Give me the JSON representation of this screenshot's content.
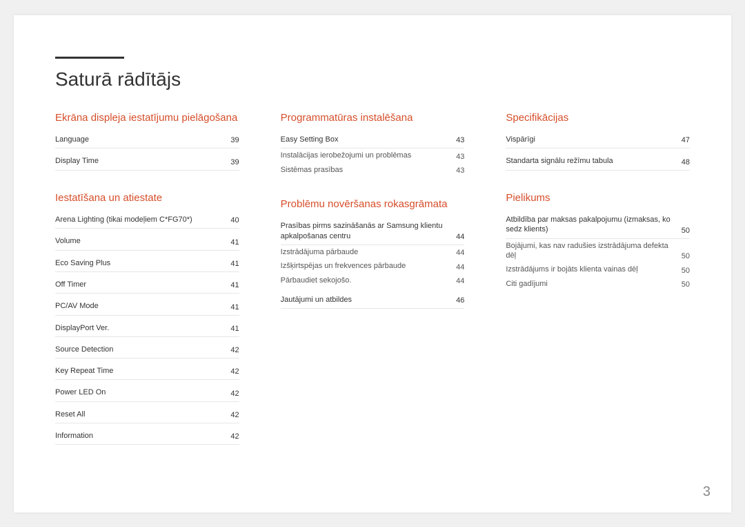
{
  "title": "Saturā rādītājs",
  "page_number": "3",
  "columns": [
    {
      "sections": [
        {
          "title": "Ekrāna displeja iestatījumu pielāgošana",
          "entries": [
            {
              "label": "Language",
              "page": "39",
              "sub": false
            },
            {
              "label": "Display Time",
              "page": "39",
              "sub": false
            }
          ]
        },
        {
          "title": "Iestatīšana un atiestate",
          "entries": [
            {
              "label": "Arena Lighting (tikai modeļiem C*FG70*)",
              "page": "40",
              "sub": false
            },
            {
              "label": "Volume",
              "page": "41",
              "sub": false
            },
            {
              "label": "Eco Saving Plus",
              "page": "41",
              "sub": false
            },
            {
              "label": "Off Timer",
              "page": "41",
              "sub": false
            },
            {
              "label": "PC/AV Mode",
              "page": "41",
              "sub": false
            },
            {
              "label": "DisplayPort Ver.",
              "page": "41",
              "sub": false
            },
            {
              "label": "Source Detection",
              "page": "42",
              "sub": false
            },
            {
              "label": "Key Repeat Time",
              "page": "42",
              "sub": false
            },
            {
              "label": "Power LED On",
              "page": "42",
              "sub": false
            },
            {
              "label": "Reset All",
              "page": "42",
              "sub": false
            },
            {
              "label": "Information",
              "page": "42",
              "sub": false
            }
          ]
        }
      ]
    },
    {
      "sections": [
        {
          "title": "Programmatūras instalēšana",
          "entries": [
            {
              "label": "Easy Setting Box",
              "page": "43",
              "sub": false
            },
            {
              "label": "Instalācijas ierobežojumi un problēmas",
              "page": "43",
              "sub": true
            },
            {
              "label": "Sistēmas prasības",
              "page": "43",
              "sub": true
            }
          ]
        },
        {
          "title": "Problēmu novēršanas rokasgrāmata",
          "entries": [
            {
              "label": "Prasības pirms sazināšanās ar Samsung klientu apkalpošanas centru",
              "page": "44",
              "sub": false
            },
            {
              "label": "Izstrādājuma pārbaude",
              "page": "44",
              "sub": true
            },
            {
              "label": "Izšķirtspējas un frekvences pārbaude",
              "page": "44",
              "sub": true
            },
            {
              "label": "Pārbaudiet sekojošo.",
              "page": "44",
              "sub": true
            },
            {
              "label": "Jautājumi un atbildes",
              "page": "46",
              "sub": false
            }
          ]
        }
      ]
    },
    {
      "sections": [
        {
          "title": "Specifikācijas",
          "entries": [
            {
              "label": "Vispārīgi",
              "page": "47",
              "sub": false
            },
            {
              "label": "Standarta signālu režīmu tabula",
              "page": "48",
              "sub": false
            }
          ]
        },
        {
          "title": "Pielikums",
          "entries": [
            {
              "label": "Atbildība par maksas pakalpojumu (izmaksas, ko sedz klients)",
              "page": "50",
              "sub": false
            },
            {
              "label": "Bojājumi, kas nav radušies izstrādājuma defekta dēļ",
              "page": "50",
              "sub": true
            },
            {
              "label": "Izstrādājums ir bojāts klienta vainas dēļ",
              "page": "50",
              "sub": true
            },
            {
              "label": "Citi gadījumi",
              "page": "50",
              "sub": true
            }
          ]
        }
      ]
    }
  ]
}
